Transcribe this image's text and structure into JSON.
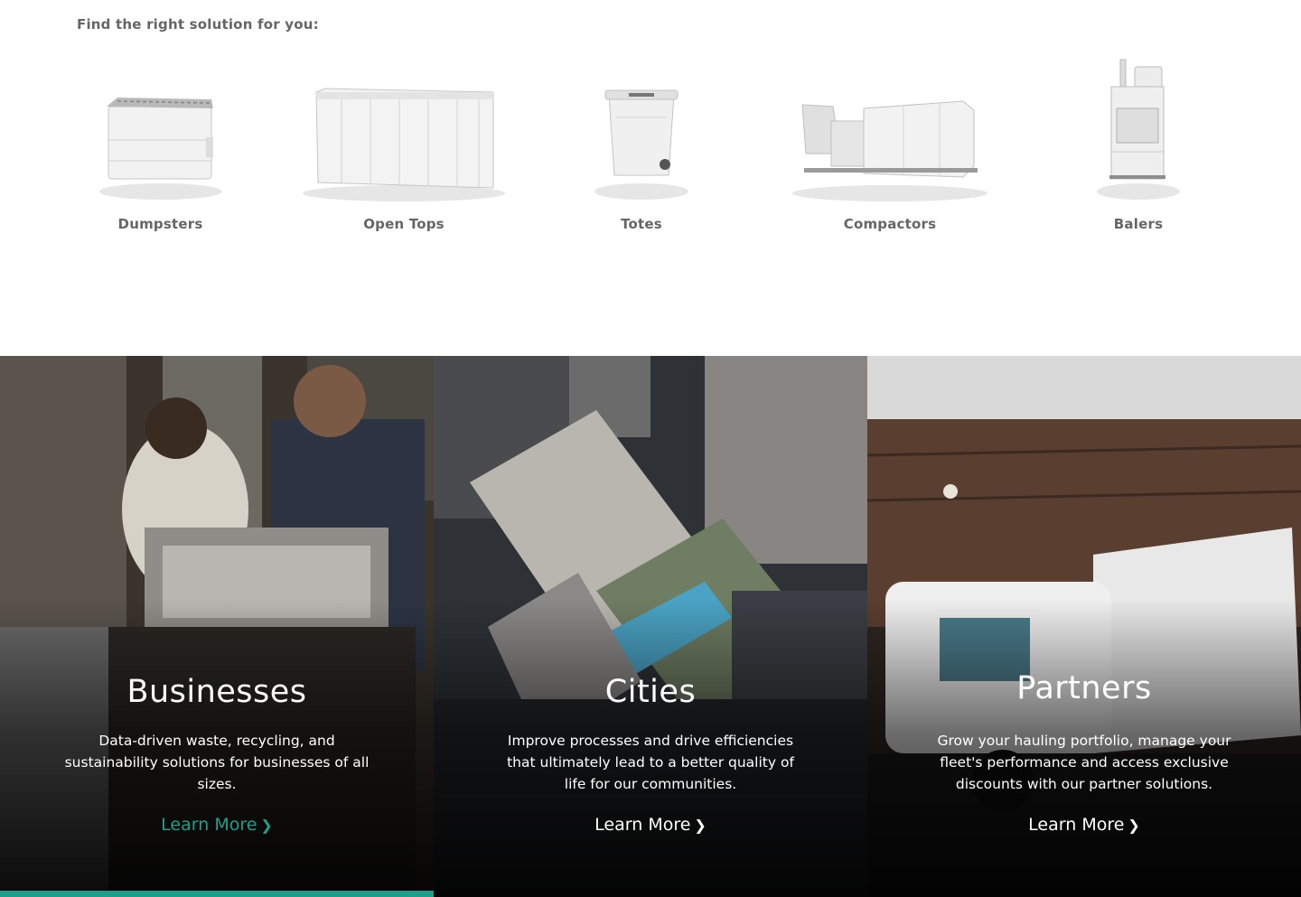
{
  "intro": "Find the right solution for you:",
  "products": [
    {
      "label": "Dumpsters",
      "icon": "dumpster-icon"
    },
    {
      "label": "Open Tops",
      "icon": "open-top-container-icon"
    },
    {
      "label": "Totes",
      "icon": "tote-cart-icon"
    },
    {
      "label": "Compactors",
      "icon": "compactor-icon"
    },
    {
      "label": "Balers",
      "icon": "baler-icon"
    }
  ],
  "segments": [
    {
      "title": "Businesses",
      "description": "Data-driven waste, recycling, and sustainability solutions for businesses of all sizes.",
      "cta": "Learn More",
      "active": true
    },
    {
      "title": "Cities",
      "description": "Improve processes and drive efficiencies that ultimately lead to a better quality of life for our communities.",
      "cta": "Learn More",
      "active": false
    },
    {
      "title": "Partners",
      "description": "Grow your hauling portfolio, manage your fleet's performance and access exclusive discounts with our partner solutions.",
      "cta": "Learn More",
      "active": false
    }
  ],
  "colors": {
    "accent": "#1e9f8c",
    "label": "#666666"
  }
}
